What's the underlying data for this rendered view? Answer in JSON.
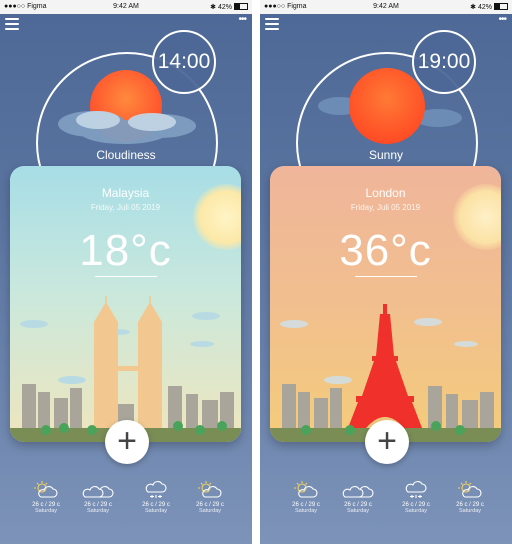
{
  "status_bar": {
    "carrier": "●●●○○ Figma",
    "time": "9:42 AM",
    "battery": "42%"
  },
  "screens": [
    {
      "time": "14:00",
      "condition": "Cloudiness",
      "city": "Malaysia",
      "date": "Friday, Juli 05 2019",
      "temperature": "18°c",
      "landmark": "petronas-towers",
      "colors": {
        "card_top": "#a7dde6",
        "card_bottom": "#f4e9ba",
        "sun": "#ff6b2d"
      },
      "forecast": [
        {
          "icon": "partly-sunny-icon",
          "temp": "26 c / 29 c",
          "day": "Saturday"
        },
        {
          "icon": "cloudy-icon",
          "temp": "26 c / 29 c",
          "day": "Saturday"
        },
        {
          "icon": "snow-cloud-icon",
          "temp": "26 c / 29 c",
          "day": "Saturday"
        },
        {
          "icon": "partly-sunny-icon",
          "temp": "26 c / 29 c",
          "day": "Saturday"
        }
      ]
    },
    {
      "time": "19:00",
      "condition": "Sunny",
      "city": "London",
      "date": "Friday, Juli 05 2019",
      "temperature": "36°c",
      "landmark": "eiffel-tower",
      "colors": {
        "card_top": "#f0b59a",
        "card_bottom": "#f3c77a",
        "sun": "#ff5a2a"
      },
      "forecast": [
        {
          "icon": "partly-sunny-icon",
          "temp": "26 c / 29 c",
          "day": "Saturday"
        },
        {
          "icon": "cloudy-icon",
          "temp": "26 c / 29 c",
          "day": "Saturday"
        },
        {
          "icon": "snow-cloud-icon",
          "temp": "26 c / 29 c",
          "day": "Saturday"
        },
        {
          "icon": "partly-sunny-icon",
          "temp": "26 c / 29 c",
          "day": "Saturday"
        }
      ]
    }
  ]
}
